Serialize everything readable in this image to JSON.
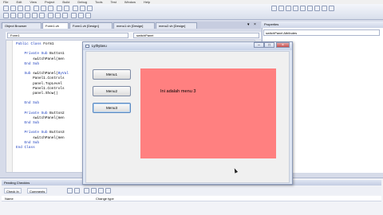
{
  "ide": {
    "menu": [
      "File",
      "Edit",
      "View",
      "Project",
      "Build",
      "Debug",
      "Tools",
      "Test",
      "Window",
      "Help"
    ],
    "doc_tabs": [
      "Object Browser",
      "Form1.vb",
      "Form1.vb [Design]",
      "menu1.vb [Design]",
      "menu2.vb [Design]"
    ],
    "combo_left": "Form1",
    "combo_right": "switchPanel",
    "code_lines": [
      {
        "text": "Public Class Form1"
      },
      {
        "text": ""
      },
      {
        "text": "    Private Sub Button1"
      },
      {
        "text": "        switchPanel(men"
      },
      {
        "text": "    End Sub"
      },
      {
        "text": ""
      },
      {
        "text": "    Sub switchPanel(ByVal"
      },
      {
        "text": "        Panel1.Controls"
      },
      {
        "text": "        panel.TopLevel"
      },
      {
        "text": "        Panel1.Controls"
      },
      {
        "text": "        panel.Show()"
      },
      {
        "text": ""
      },
      {
        "text": "    End Sub"
      },
      {
        "text": ""
      },
      {
        "text": "    Private Sub Button2"
      },
      {
        "text": "        switchPanel(men"
      },
      {
        "text": "    End Sub"
      },
      {
        "text": ""
      },
      {
        "text": "    Private Sub Button3"
      },
      {
        "text": "        switchPanel(men"
      },
      {
        "text": "    End Sub"
      },
      {
        "text": "End Class"
      }
    ],
    "properties_title": "Properties",
    "properties_selected": "switchPanel Attributes",
    "pending_title": "Pending Checkins",
    "pending_toolbar": [
      "Check In",
      "Comments"
    ],
    "pending_columns": [
      "Name",
      "Change type"
    ]
  },
  "form": {
    "title": "Lythytavu",
    "buttons": [
      "Menu1",
      "Menu2",
      "Menu3"
    ],
    "panel_text": "Ini adalah menu 3",
    "panel_color": "#ff8080"
  }
}
